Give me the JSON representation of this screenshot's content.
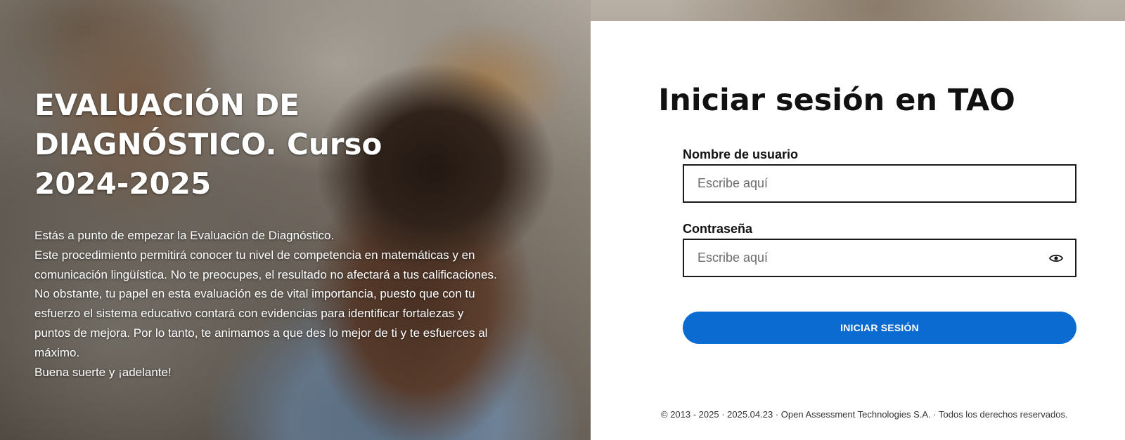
{
  "hero": {
    "title": "EVALUACIÓN DE DIAGNÓSTICO. Curso 2024-2025",
    "paragraphs": [
      "Estás a punto de empezar la Evaluación de Diagnóstico.",
      "Este procedimiento permitirá conocer tu nivel de competencia en matemáticas y en comunicación lingüística. No te preocupes, el resultado no afectará a tus calificaciones.",
      "No obstante, tu papel en esta evaluación es de vital importancia, puesto que con tu esfuerzo el sistema educativo contará con evidencias para identificar fortalezas y puntos de mejora. Por lo tanto, te animamos a que des lo mejor de ti y te esfuerces al máximo.",
      "Buena suerte y ¡adelante!"
    ]
  },
  "login": {
    "title": "Iniciar sesión en TAO",
    "username": {
      "label": "Nombre de usuario",
      "placeholder": "Escribe aquí",
      "value": ""
    },
    "password": {
      "label": "Contraseña",
      "placeholder": "Escribe aquí",
      "value": "",
      "toggle_icon": "eye-icon"
    },
    "submit_label": "INICIAR SESIÓN"
  },
  "footer": {
    "text": "© 2013 - 2025 · 2025.04.23 · Open Assessment Technologies S.A. · Todos los derechos reservados."
  },
  "colors": {
    "primary_button": "#0b6bd0",
    "panel_background": "#ffffff",
    "hero_text": "#ffffff",
    "title_text": "#111111"
  }
}
